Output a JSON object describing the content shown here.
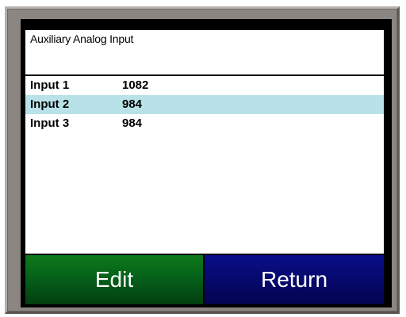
{
  "screen": {
    "title": "Auxiliary Analog Input"
  },
  "inputs": [
    {
      "label": "Input 1",
      "value": "1082",
      "selected": false
    },
    {
      "label": "Input 2",
      "value": "984",
      "selected": true
    },
    {
      "label": "Input 3",
      "value": "984",
      "selected": false
    }
  ],
  "buttons": {
    "edit_label": "Edit",
    "return_label": "Return"
  },
  "colors": {
    "selection": "#b9e1e8",
    "edit_button": "#05611a",
    "return_button": "#06096f",
    "bezel": "#8c8682"
  }
}
